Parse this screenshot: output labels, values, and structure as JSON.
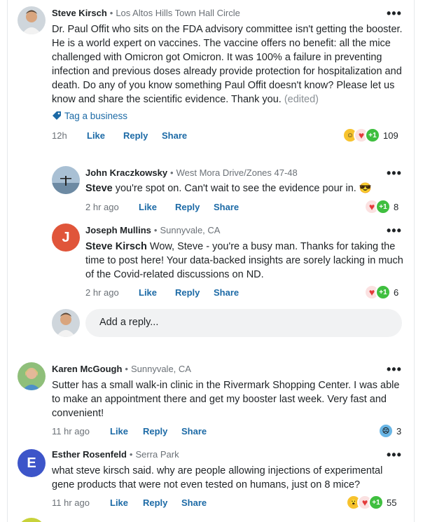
{
  "comments": [
    {
      "author": "Steve Kirsch",
      "location": "Los Altos Hills Town Hall Circle",
      "text": "Dr. Paul Offit who sits on the FDA advisory committee isn't getting the booster. He is a world expert on vaccines. The vaccine offers no benefit: all the mice challenged with Omicron got Omicron. It was 100% a failure in preventing infection and previous doses already provide protection for hospitalization and death. Do any of you know something Paul Offit doesn't know? Please let us know and share the scientific evidence. Thank you.",
      "edited": "(edited)",
      "tag_label": "Tag a business",
      "time": "12h",
      "reaction_count": "109"
    },
    {
      "author": "John Kraczkowsky",
      "location": "West Mora Drive/Zones 47-48",
      "mention": "Steve",
      "text": "you're spot on. Can't wait to see the evidence pour in.",
      "emoji": "😎",
      "time": "2 hr ago",
      "reaction_count": "8"
    },
    {
      "author": "Joseph Mullins",
      "location": "Sunnyvale, CA",
      "avatar_letter": "J",
      "mention": "Steve Kirsch",
      "text": "Wow, Steve - you're a busy man.  Thanks for taking the time to post here!  Your data-backed insights are sorely lacking in much of the Covid-related discussions on ND.",
      "time": "2 hr ago",
      "reaction_count": "6"
    },
    {
      "author": "Karen McGough",
      "location": "Sunnyvale, CA",
      "text": "Sutter has a small walk-in clinic in the Rivermark Shopping Center. I was able to make an appointment there and get my booster last week. Very fast and convenient!",
      "time": "11 hr ago",
      "reaction_count": "3"
    },
    {
      "author": "Esther Rosenfeld",
      "location": "Serra Park",
      "avatar_letter": "E",
      "text": "what steve kirsch said. why are people allowing injections of experimental gene products that were not even tested on humans, just on 8 mice?",
      "time": "11 hr ago",
      "reaction_count": "55"
    }
  ],
  "actions": {
    "like": "Like",
    "reply": "Reply",
    "share": "Share"
  },
  "reply_placeholder": "Add a reply...",
  "separator": "•",
  "more_glyph": "•••",
  "colors": {
    "link": "#1c6aa6",
    "joseph_avatar": "#e0553a",
    "esther_avatar": "#3d55c9"
  }
}
